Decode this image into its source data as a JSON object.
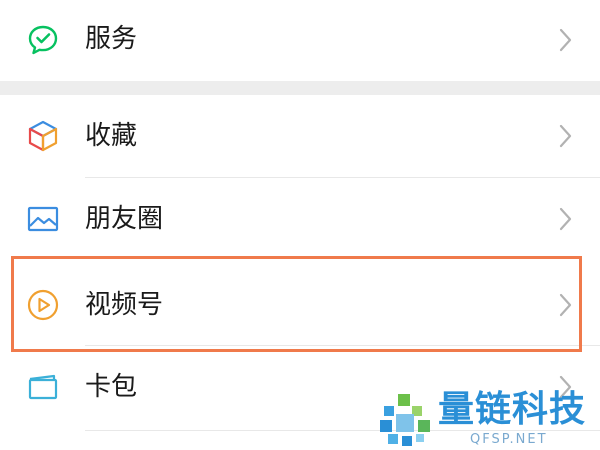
{
  "menu": {
    "services": {
      "label": "服务",
      "icon": "services-icon"
    },
    "favorites": {
      "label": "收藏",
      "icon": "favorites-cube-icon"
    },
    "moments": {
      "label": "朋友圈",
      "icon": "moments-image-icon"
    },
    "channels": {
      "label": "视频号",
      "icon": "channels-play-icon"
    },
    "cards": {
      "label": "卡包",
      "icon": "card-wallet-icon"
    }
  },
  "watermark": {
    "brand": "量链科技",
    "url": "QFSP.NET"
  },
  "colors": {
    "highlight": "#f07a4b",
    "services_green": "#07c160",
    "favorites_blue": "#3b8de0",
    "favorites_orange": "#f0a030",
    "moments_blue": "#3b8de0",
    "channels_orange": "#f0a030",
    "cards_blue": "#3bb0d8",
    "watermark_blue": "#2a8fd6"
  }
}
